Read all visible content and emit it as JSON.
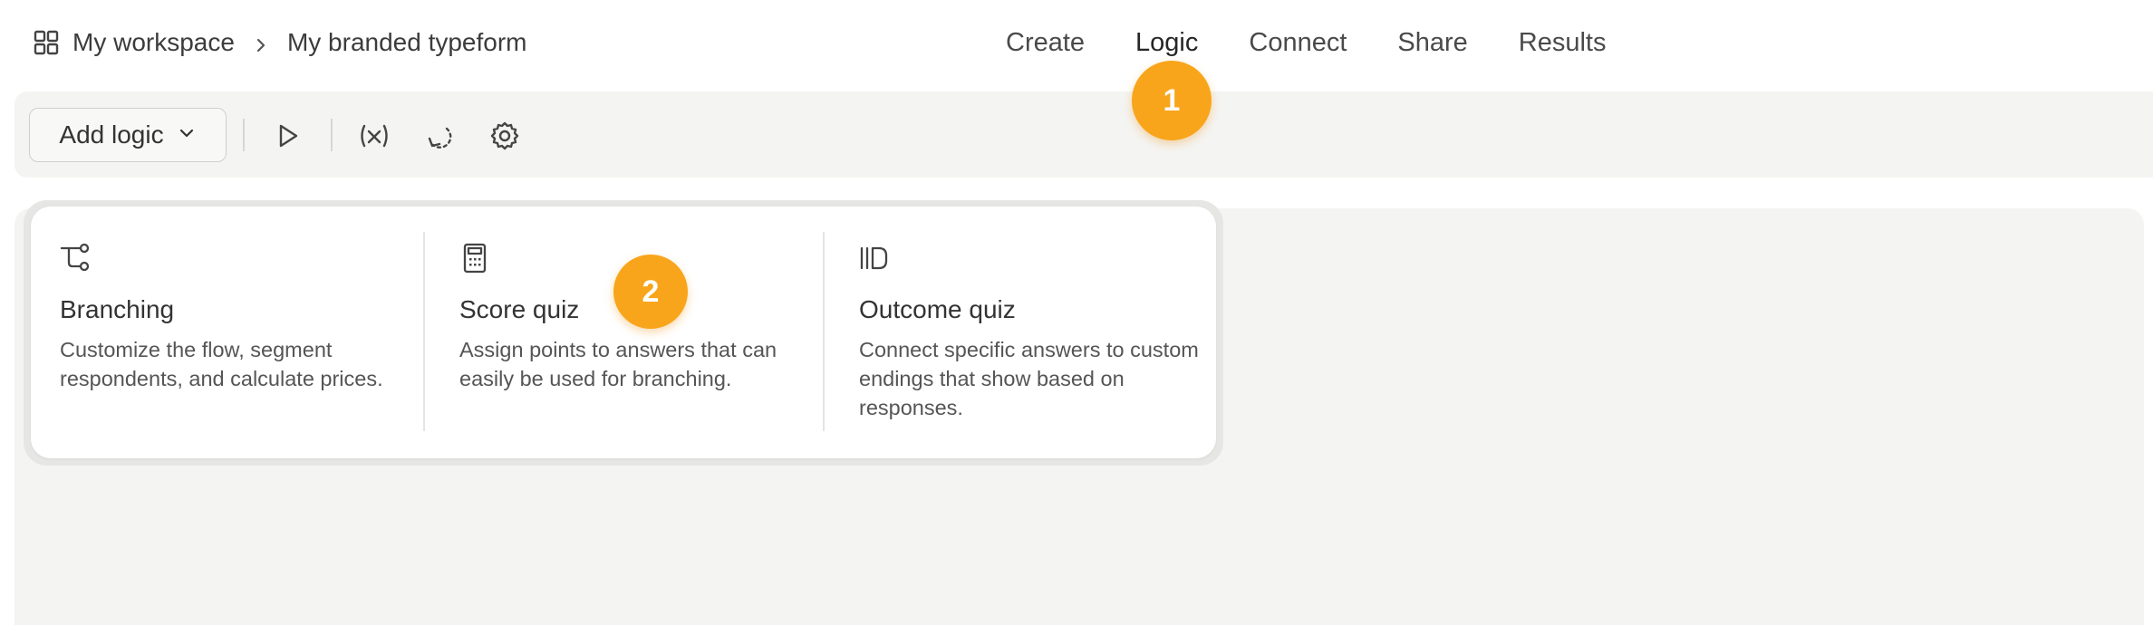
{
  "breadcrumb": {
    "workspace": "My workspace",
    "form": "My branded typeform"
  },
  "nav": {
    "tabs": [
      "Create",
      "Logic",
      "Connect",
      "Share",
      "Results"
    ],
    "active": "Logic"
  },
  "toolbar": {
    "add_logic_label": "Add logic",
    "icons": [
      "play-icon",
      "variable-icon",
      "refresh-icon",
      "settings-icon"
    ]
  },
  "logic_menu": {
    "options": [
      {
        "title": "Branching",
        "description": "Customize the flow, segment respondents, and calculate prices.",
        "icon": "branching-icon"
      },
      {
        "title": "Score quiz",
        "description": "Assign points to answers that can easily be used for branching.",
        "icon": "calculator-icon"
      },
      {
        "title": "Outcome quiz",
        "description": "Connect specific answers to custom endings that show based on responses.",
        "icon": "outcome-icon"
      }
    ]
  },
  "markers": [
    "1",
    "2"
  ],
  "colors": {
    "marker": "#f8a51b",
    "panel_bg": "#f4f4f2"
  }
}
